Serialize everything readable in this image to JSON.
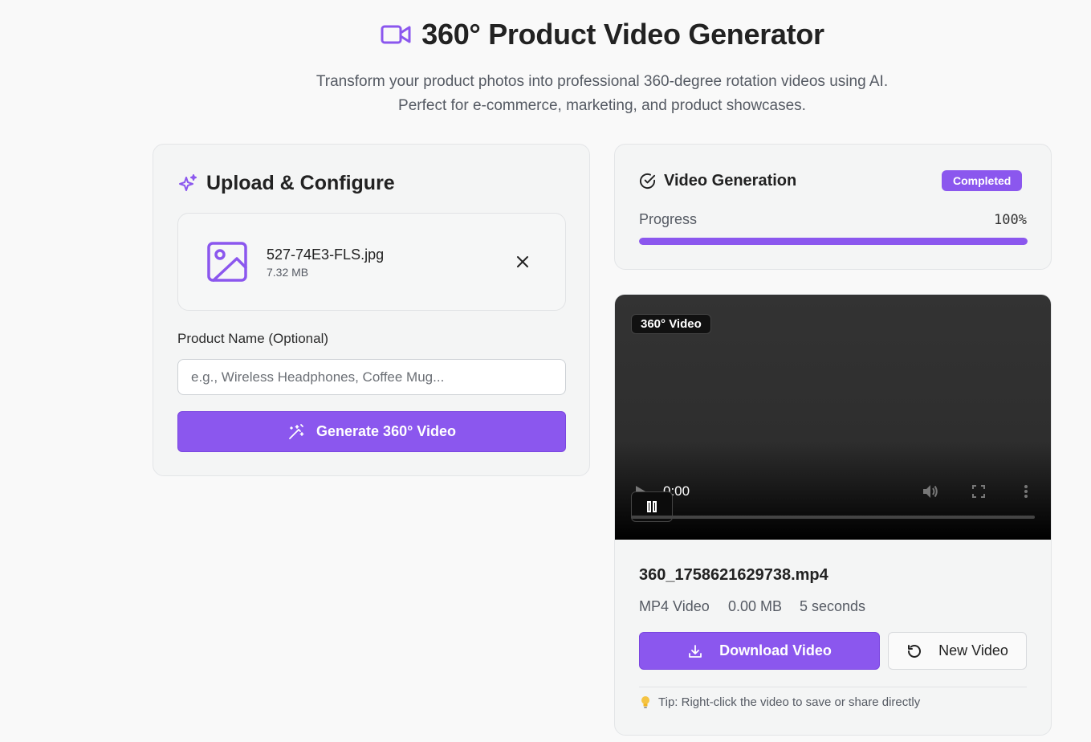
{
  "header": {
    "title": "360° Product Video Generator",
    "subtitle_line1": "Transform your product photos into professional 360-degree rotation videos using AI.",
    "subtitle_line2": "Perfect for e-commerce, marketing, and product showcases."
  },
  "upload": {
    "title": "Upload & Configure",
    "file_name": "527-74E3-FLS.jpg",
    "file_size": "7.32 MB",
    "product_label": "Product Name (Optional)",
    "product_placeholder": "e.g., Wireless Headphones, Coffee Mug...",
    "generate_label": "Generate 360° Video"
  },
  "generation": {
    "title": "Video Generation",
    "status": "Completed",
    "progress_label": "Progress",
    "progress_text": "100%",
    "progress_value": 1.0
  },
  "video": {
    "tag": "360° Video",
    "time": "0:00",
    "file_name": "360_1758621629738.mp4",
    "format": "MP4 Video",
    "size": "0.00 MB",
    "duration": "5 seconds",
    "download_label": "Download Video",
    "new_label": "New Video",
    "tip": "Tip: Right-click the video to save or share directly"
  },
  "colors": {
    "accent": "#8b57ee",
    "card_bg": "#f4f5f5",
    "page_bg": "#f9f9f9"
  },
  "icons": [
    "video-camera-icon",
    "sparkles-icon",
    "image-icon",
    "close-icon",
    "wand-icon",
    "check-circle-icon",
    "play-icon",
    "pause-icon",
    "volume-icon",
    "fullscreen-icon",
    "more-vertical-icon",
    "download-icon",
    "refresh-icon",
    "lightbulb-icon"
  ]
}
